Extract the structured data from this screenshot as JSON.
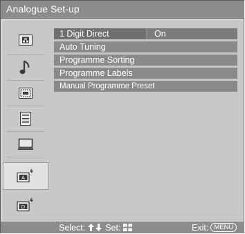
{
  "window": {
    "title": "Analogue Set-up"
  },
  "sidebar": {
    "items": [
      {
        "icon": "picture-icon"
      },
      {
        "icon": "music-note-icon"
      },
      {
        "icon": "screen-layout-icon"
      },
      {
        "icon": "features-list-icon"
      },
      {
        "icon": "monitor-icon"
      },
      {
        "icon": "analogue-setup-icon",
        "selected": true,
        "glyph": "A"
      },
      {
        "icon": "digital-setup-icon",
        "glyph": "D"
      }
    ]
  },
  "menu": {
    "items": [
      {
        "label": "1 Digit Direct",
        "value": "On"
      },
      {
        "label": "Auto Tuning"
      },
      {
        "label": "Programme Sorting"
      },
      {
        "label": "Programme Labels"
      },
      {
        "label": "Manual Programme Preset"
      }
    ]
  },
  "footer": {
    "select_label": "Select:",
    "set_label": "Set:",
    "exit_label": "Exit:",
    "menu_button": "MENU"
  },
  "colors": {
    "bar": "#8c8c8c",
    "background": "#d2d2d2",
    "row": "#8a8a8a",
    "text": "#ffffff"
  }
}
